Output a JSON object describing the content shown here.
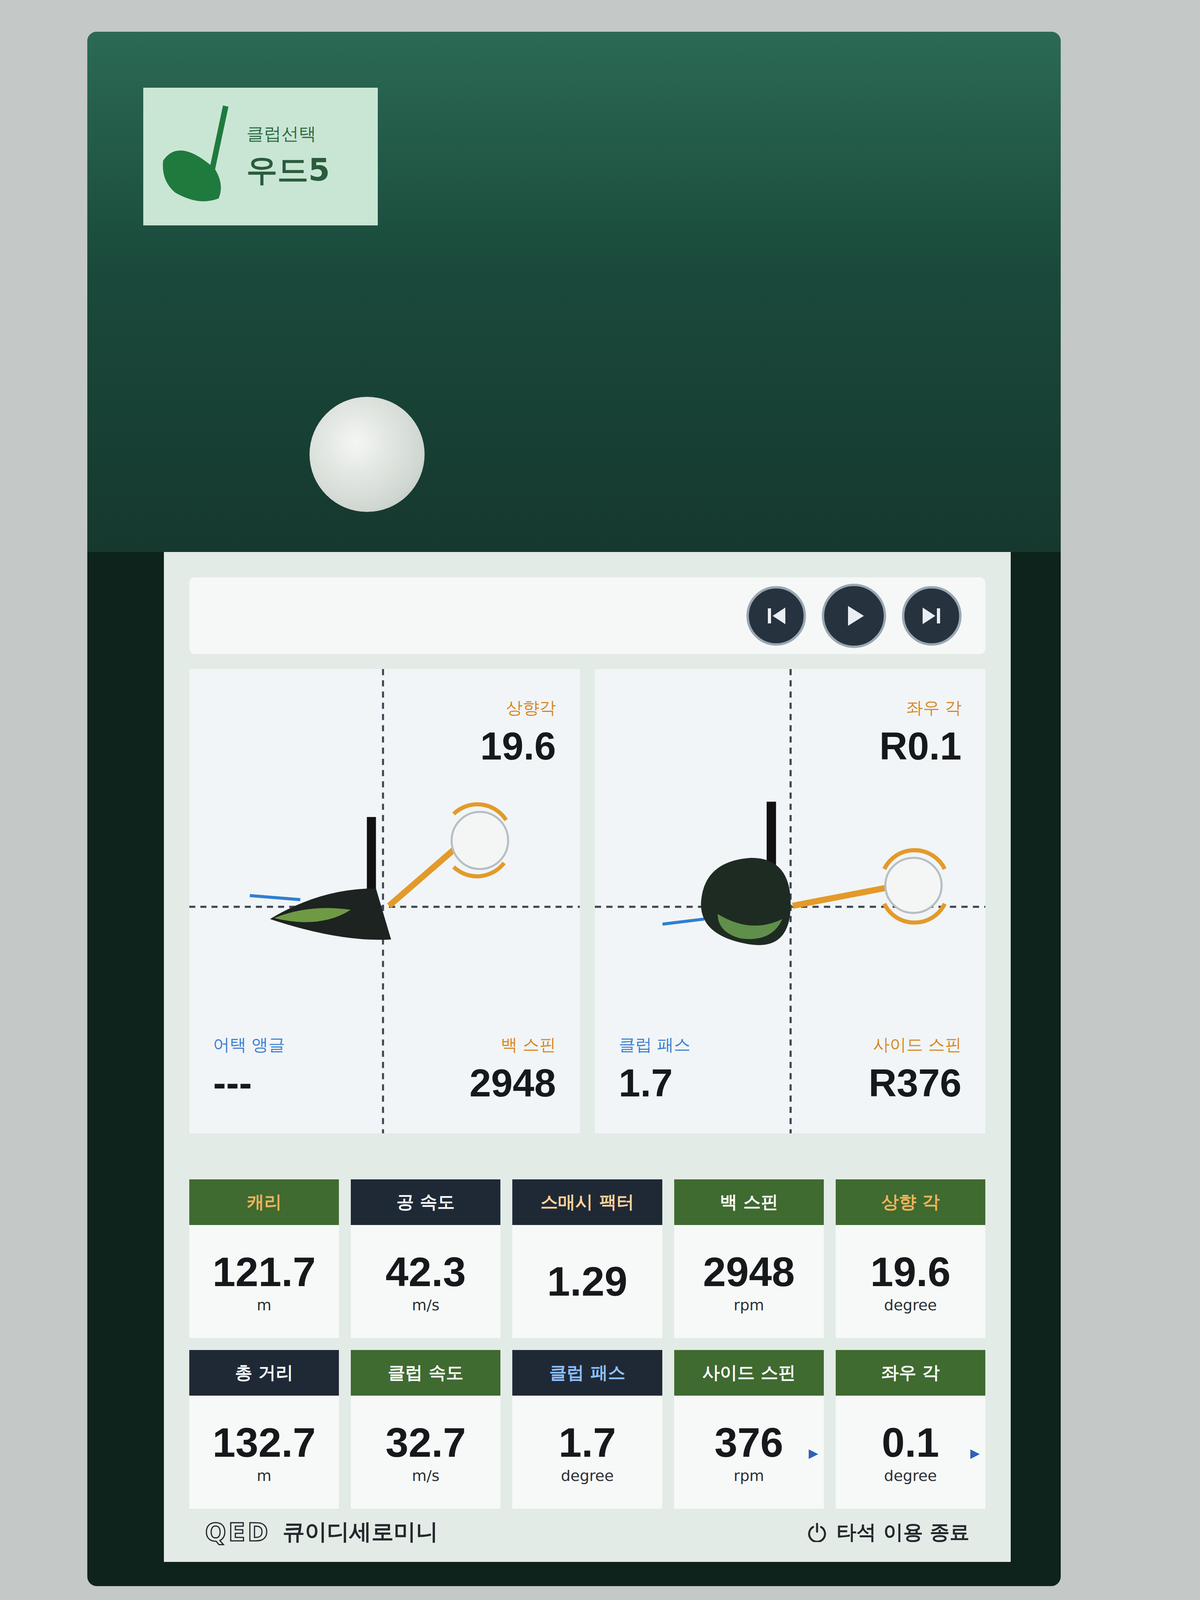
{
  "header": {
    "label": "클럽선택",
    "club": "우드5"
  },
  "diagrams": [
    {
      "kind": "side",
      "title": "상향각",
      "value": "19.6",
      "left_label": "어택 앵글",
      "left_value": "---",
      "right_label": "백 스핀",
      "right_value": "2948"
    },
    {
      "kind": "face",
      "title": "좌우 각",
      "value": "R0.1",
      "left_label": "클럽 패스",
      "left_value": "1.7",
      "right_label": "사이드 스핀",
      "right_value": "R376"
    }
  ],
  "stats": [
    {
      "label": "캐리",
      "value": "121.7",
      "unit": "m",
      "color": "#3f6a30",
      "label_color": "#f0b45a",
      "arrow": ""
    },
    {
      "label": "공 속도",
      "value": "42.3",
      "unit": "m/s",
      "color": "#1f2936",
      "label_color": "#ffffff",
      "arrow": ""
    },
    {
      "label": "스매시 팩터",
      "value": "1.29",
      "unit": "",
      "color": "#1f2936",
      "label_color": "#ffd39a",
      "arrow": ""
    },
    {
      "label": "백 스핀",
      "value": "2948",
      "unit": "rpm",
      "color": "#3f6a30",
      "label_color": "#ffffff",
      "arrow": ""
    },
    {
      "label": "상향 각",
      "value": "19.6",
      "unit": "degree",
      "color": "#3f6a30",
      "label_color": "#f0b45a",
      "arrow": ""
    },
    {
      "label": "총 거리",
      "value": "132.7",
      "unit": "m",
      "color": "#1f2936",
      "label_color": "#ffffff",
      "arrow": ""
    },
    {
      "label": "클럽 속도",
      "value": "32.7",
      "unit": "m/s",
      "color": "#3f6a30",
      "label_color": "#ffffff",
      "arrow": ""
    },
    {
      "label": "클럽 패스",
      "value": "1.7",
      "unit": "degree",
      "color": "#1f2936",
      "label_color": "#8fc0ff",
      "arrow": ""
    },
    {
      "label": "사이드 스핀",
      "value": "376",
      "unit": "rpm",
      "color": "#3f6a30",
      "label_color": "#ffffff",
      "arrow": "▸"
    },
    {
      "label": "좌우 각",
      "value": "0.1",
      "unit": "degree",
      "color": "#3f6a30",
      "label_color": "#ffffff",
      "arrow": "▸"
    }
  ],
  "footer": {
    "logo": "QED",
    "brand": "큐이디세로미니",
    "end_button": "타석 이용 종료"
  }
}
